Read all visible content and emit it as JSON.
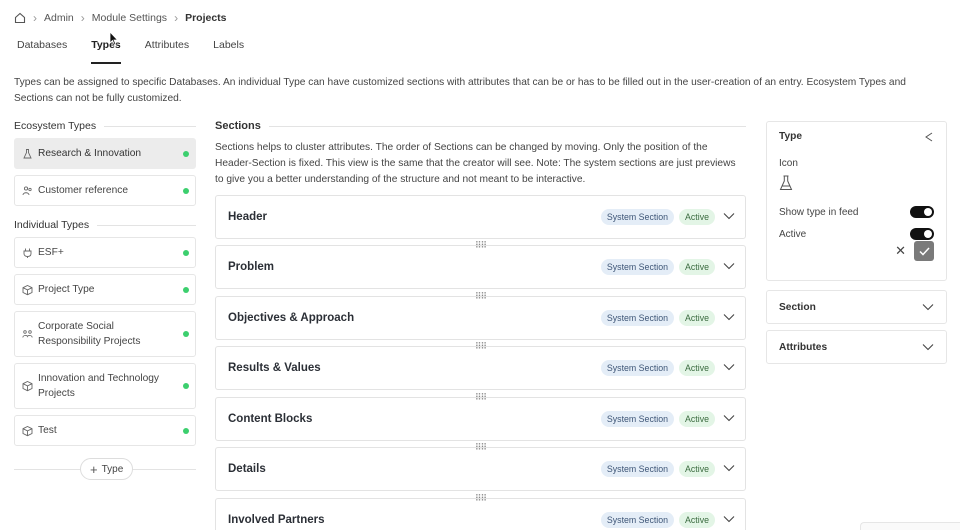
{
  "breadcrumb": {
    "items": [
      "Admin",
      "Module Settings"
    ],
    "current": "Projects"
  },
  "tabs": [
    {
      "label": "Databases",
      "active": false
    },
    {
      "label": "Types",
      "active": true
    },
    {
      "label": "Attributes",
      "active": false
    },
    {
      "label": "Labels",
      "active": false
    }
  ],
  "intro": "Types can be assigned to specific Databases. An individual Type can have customized sections with attributes that can be or has to be filled out in the user-creation of an entry. Ecosystem Types and Sections can not be fully customized.",
  "ecosystem": {
    "heading": "Ecosystem Types",
    "items": [
      {
        "label": "Research & Innovation",
        "icon": "flask-icon"
      },
      {
        "label": "Customer reference",
        "icon": "people-icon"
      }
    ]
  },
  "individual": {
    "heading": "Individual Types",
    "items": [
      {
        "label": "ESF+",
        "icon": "plug-icon"
      },
      {
        "label": "Project Type",
        "icon": "cube-icon"
      },
      {
        "label": "Corporate Social Responsibility Projects",
        "icon": "team-icon"
      },
      {
        "label": "Innovation and Technology Projects",
        "icon": "cube-icon"
      },
      {
        "label": "Test",
        "icon": "cube-icon"
      }
    ]
  },
  "add_type_label": "Type",
  "sections": {
    "heading": "Sections",
    "description": "Sections helps to cluster attributes. The order of Sections can be changed by moving. Only the position of the Header-Section is fixed. This view is the same that the creator will see. Note: The system sections are just previews to give you a better understanding of the structure and not meant to be interactive.",
    "system_badge": "System Section",
    "active_badge": "Active",
    "rows": [
      "Header",
      "Problem",
      "Objectives & Approach",
      "Results & Values",
      "Content Blocks",
      "Details",
      "Involved Partners"
    ]
  },
  "type_panel": {
    "title": "Type",
    "icon_label": "Icon",
    "show_in_feed_label": "Show type in feed",
    "active_label": "Active",
    "show_in_feed": true,
    "active": true
  },
  "accordions": {
    "section": "Section",
    "attributes": "Attributes"
  },
  "colors": {
    "status_dot": "#3ccf6e",
    "system_badge_bg": "#e4edf7",
    "active_badge_bg": "#e3f5e6",
    "toggle_on": "#111111"
  }
}
